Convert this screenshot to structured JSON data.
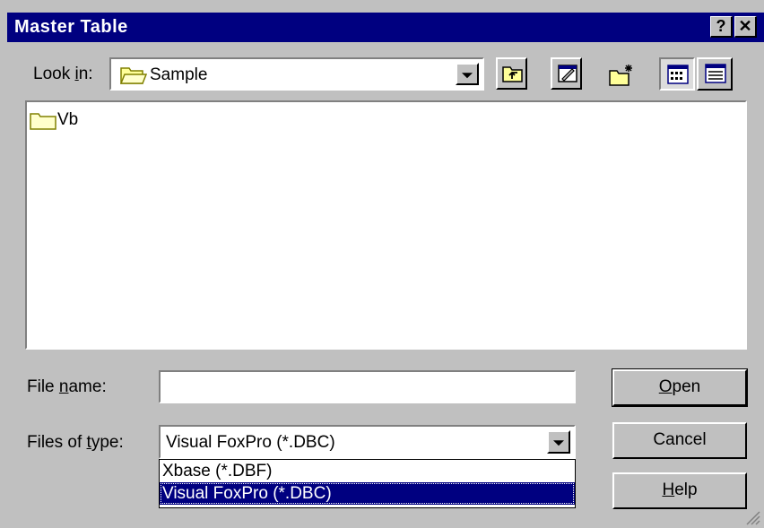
{
  "window": {
    "title": "Master Table",
    "help_button": "?",
    "close_button": "✕"
  },
  "lookin": {
    "label_pre": "Look ",
    "label_ul": "i",
    "label_post": "n:",
    "value": "Sample",
    "icons": [
      "up-one-level-icon",
      "favorites-icon",
      "new-folder-icon",
      "list-view-icon",
      "details-view-icon"
    ]
  },
  "files": [
    {
      "name": "Vb",
      "icon": "folder-icon"
    }
  ],
  "filename": {
    "label_pre": "File ",
    "label_ul": "n",
    "label_post": "ame:",
    "value": ""
  },
  "filetype": {
    "label_pre": "Files of ",
    "label_ul": "t",
    "label_post": "ype:",
    "value": "Visual FoxPro (*.DBC)",
    "options": [
      "Xbase (*.DBF)",
      "Visual FoxPro (*.DBC)"
    ],
    "selected_index": 1
  },
  "buttons": {
    "open_ul": "O",
    "open_rest": "pen",
    "cancel": "Cancel",
    "help_ul": "H",
    "help_rest": "elp"
  }
}
